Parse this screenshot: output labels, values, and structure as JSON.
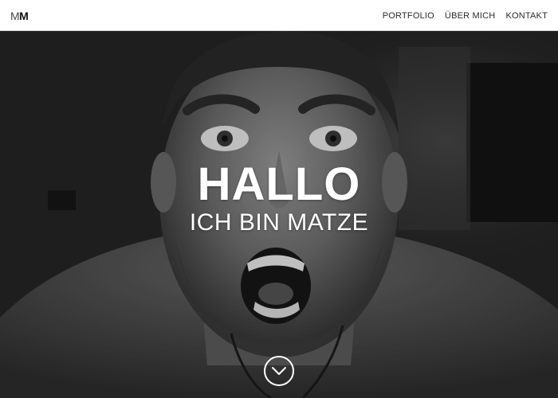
{
  "nav": {
    "logo_thin": "M",
    "logo_bold": "M",
    "links": [
      {
        "label": "PORTFOLIO"
      },
      {
        "label": "ÜBER MICH"
      },
      {
        "label": "KONTAKT"
      }
    ]
  },
  "hero": {
    "title": "HALLO",
    "subtitle": "ICH BIN MATZE",
    "photo_icon": "portrait-photo",
    "scroll_icon": "chevron-down-icon"
  },
  "colors": {
    "nav_background": "#ffffff",
    "text_dark": "#2a2a2a",
    "hero_text": "#ffffff"
  }
}
